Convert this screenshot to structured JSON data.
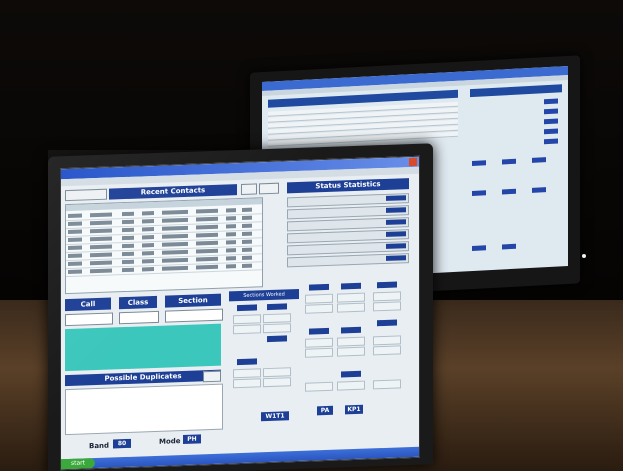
{
  "window": {
    "title": "",
    "close": "",
    "recent_contacts_title": "Recent Contacts",
    "booth_button": "",
    "btn_a": "",
    "btn_b": "",
    "status_bar_title": "Status Statistics"
  },
  "contacts_table": {
    "columns": [
      "",
      "",
      "",
      "",
      "",
      "",
      "",
      "",
      ""
    ],
    "rows": 8
  },
  "actions": {
    "call": "Call",
    "class": "Class",
    "section": "Section",
    "possible_duplicates": "Possible Duplicates",
    "dup_button": "",
    "sections_worked": "Sections Worked",
    "band_label": "Band",
    "band_value": "80",
    "mode_label": "Mode",
    "mode_value": "PH",
    "bottom_b1": "W1T1",
    "bottom_b2": "PA",
    "bottom_b3": "KP1"
  },
  "taskbar": {
    "start": "start"
  },
  "colors": {
    "accent": "#1d3f96",
    "teal": "#3cc7bc",
    "titlebar": "#1f4fc8"
  }
}
